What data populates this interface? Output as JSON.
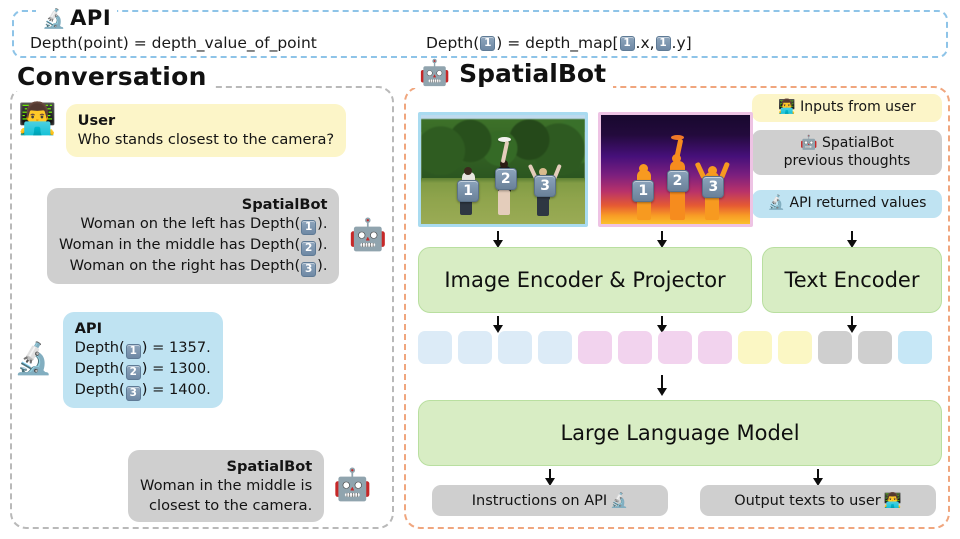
{
  "api_strip": {
    "title": "API",
    "title_icon": "microscope-icon",
    "title_emoji": "🔬",
    "left_formula": "Depth(point) = depth_value_of_point",
    "right_formula_parts": [
      "Depth( ",
      " ) = depth_map[",
      ".x, ",
      ".y]"
    ],
    "badge_value": "1",
    "border_color": "#8ec4e8"
  },
  "conversation": {
    "title": "Conversation",
    "border_color": "#b9b9b9",
    "messages": [
      {
        "id": "user-question",
        "avatar": "👨‍💻",
        "avatar_name": "user-avatar-icon",
        "who": "User",
        "text": "Who stands closest to the camera?",
        "bubble_color": "#fcf5c8"
      },
      {
        "id": "bot-depth-listing",
        "avatar": "🤖",
        "avatar_name": "robot-avatar-icon",
        "who": "SpatialBot",
        "lines": [
          {
            "pre": "Woman on the left has Depth(",
            "badge": "1",
            "post": ")."
          },
          {
            "pre": "Woman in the middle has Depth(",
            "badge": "2",
            "post": ")."
          },
          {
            "pre": "Woman on the right has Depth(",
            "badge": "3",
            "post": ")."
          }
        ],
        "bubble_color": "#cfcfcf"
      },
      {
        "id": "api-values",
        "avatar": "🔬",
        "avatar_name": "microscope-avatar-icon",
        "who": "API",
        "lines": [
          {
            "pre": "Depth(",
            "badge": "1",
            "post": ") = 1357."
          },
          {
            "pre": "Depth(",
            "badge": "2",
            "post": ") = 1300."
          },
          {
            "pre": "Depth(",
            "badge": "3",
            "post": ") = 1400."
          }
        ],
        "bubble_color": "#bfe3f2"
      },
      {
        "id": "bot-answer",
        "avatar": "🤖",
        "avatar_name": "robot-avatar-icon",
        "who": "SpatialBot",
        "text_line1": "Woman in the middle is",
        "text_line2": "closest to the camera.",
        "bubble_color": "#cfcfcf"
      }
    ]
  },
  "spatialbot": {
    "title": "SpatialBot",
    "title_emoji": "🤖",
    "border_color": "#f0a67e",
    "legend": [
      {
        "id": "inputs-from-user",
        "emoji": "👨‍💻",
        "label": "Inputs from user",
        "color": "#fcf5c8"
      },
      {
        "id": "previous-thoughts",
        "emoji": "🤖",
        "label_line1": "SpatialBot",
        "label_line2": "previous thoughts",
        "color": "#cfcfcf"
      },
      {
        "id": "api-returned-values",
        "emoji": "🔬",
        "label": "API returned values",
        "color": "#bfe3f2"
      }
    ],
    "images": [
      {
        "id": "rgb-image",
        "alt": "women playing frisbee on grass field",
        "border": "#a9dbf0",
        "badges": [
          "1",
          "2",
          "3"
        ]
      },
      {
        "id": "depth-image",
        "alt": "inferno depth map of the same scene",
        "border": "#eec3e4",
        "badges": [
          "1",
          "2",
          "3"
        ]
      }
    ],
    "encoders": [
      {
        "id": "image-encoder",
        "label": "Image Encoder & Projector",
        "color": "#d8edc4"
      },
      {
        "id": "text-encoder",
        "label": "Text Encoder",
        "color": "#d8edc4"
      }
    ],
    "tokens": [
      "#dcebf7",
      "#dcebf7",
      "#dcebf7",
      "#dcebf7",
      "#f2d3ee",
      "#f2d3ee",
      "#f2d3ee",
      "#f2d3ee",
      "#fbf7c4",
      "#fbf7c4",
      "#cfcfcf",
      "#cfcfcf",
      "#c6e7f6"
    ],
    "llm": {
      "id": "large-language-model",
      "label": "Large Language Model",
      "color": "#d8edc4"
    },
    "outputs": [
      {
        "id": "instructions-on-api",
        "label": "Instructions on API",
        "emoji": "🔬",
        "color": "#cfcfcf"
      },
      {
        "id": "output-texts-to-user",
        "label": "Output texts to user",
        "emoji": "👨‍💻",
        "color": "#cfcfcf"
      }
    ]
  }
}
